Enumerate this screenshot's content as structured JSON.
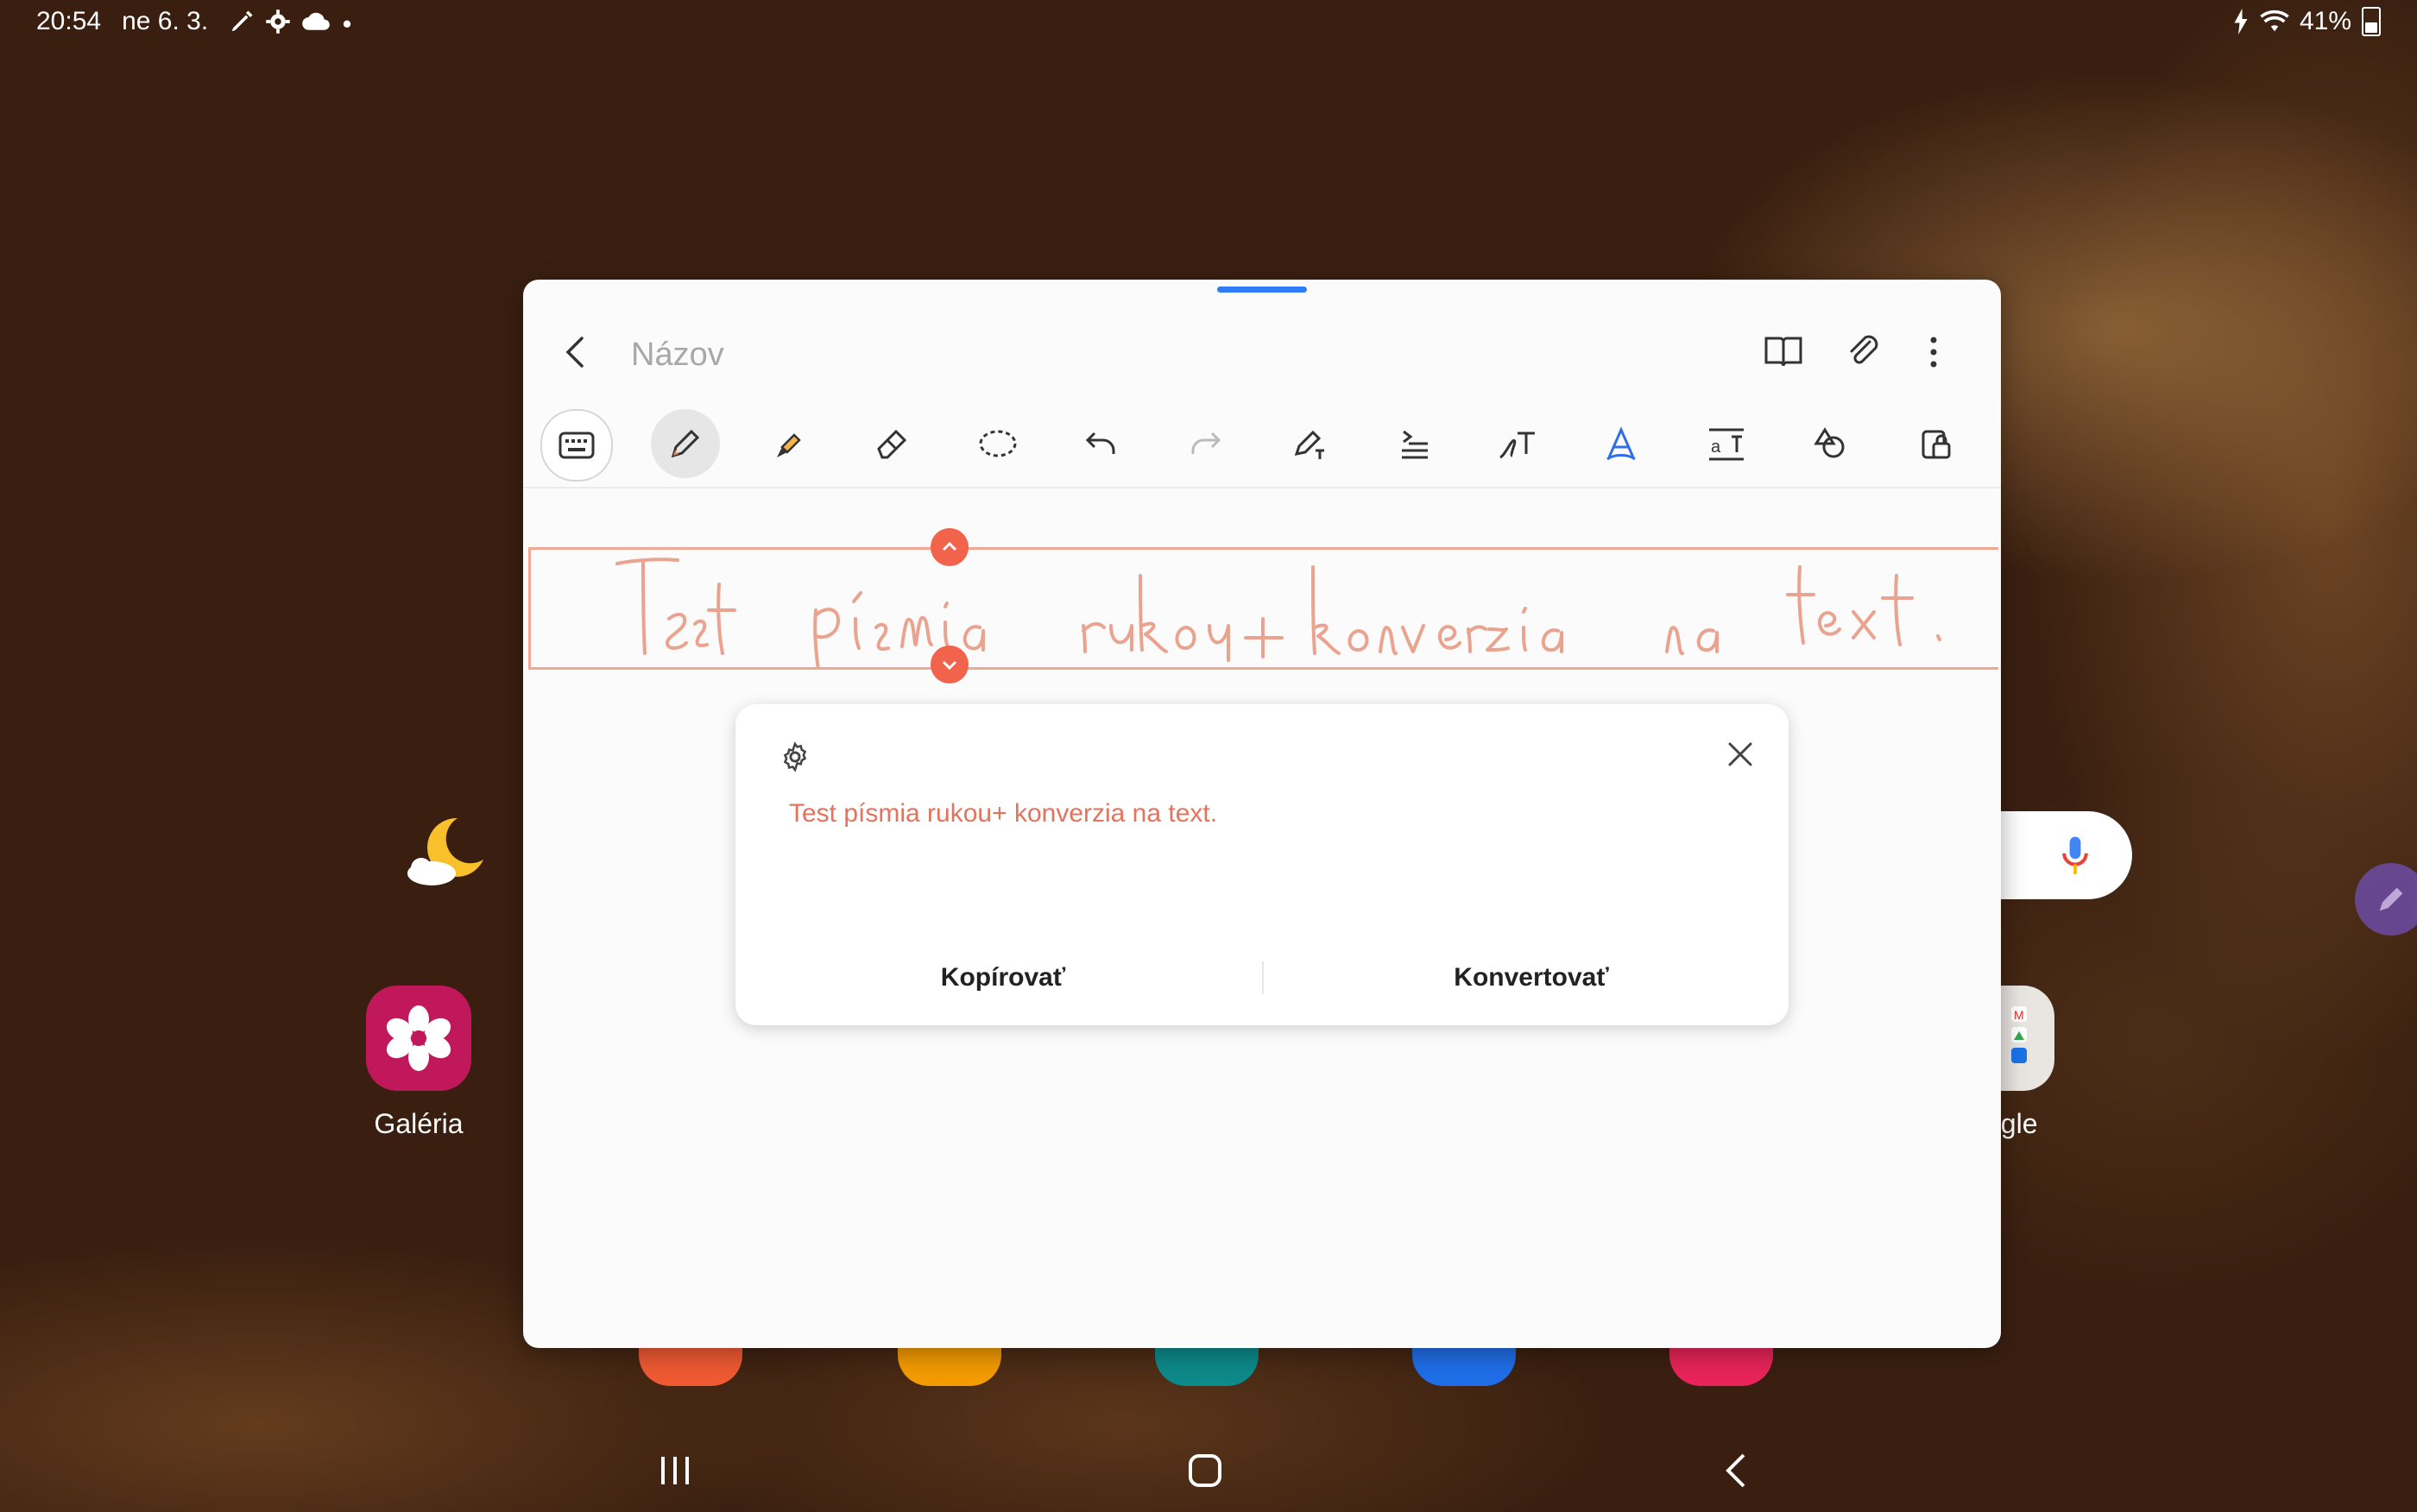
{
  "status_bar": {
    "time": "20:54",
    "date": "ne 6. 3.",
    "battery": "41%",
    "battery_level": 0.41,
    "icons": [
      "pen-icon",
      "gear-icon",
      "cloud-icon",
      "dot-icon",
      "charging-icon",
      "wifi-icon",
      "battery-icon"
    ]
  },
  "note": {
    "title_placeholder": "Názov",
    "header_icons": [
      "book-view-icon",
      "attach-icon",
      "more-icon"
    ],
    "toolbar": [
      "keyboard",
      "pen",
      "highlighter",
      "eraser",
      "lasso",
      "undo",
      "redo",
      "pen-to-text",
      "straighten",
      "handwriting-to-text",
      "text-style",
      "text-size",
      "shapes",
      "lock"
    ],
    "handwriting": "Test písmia rukou + konverzia na text.",
    "ink_color": "#eaa38f"
  },
  "convert_card": {
    "converted_text": "Test písmia rukou+ konverzia na text.",
    "copy_label": "Kopírovať",
    "convert_label": "Konvertovať"
  },
  "home": {
    "gallery_label": "Galéria",
    "google_label_partial": "ogle"
  },
  "colors": {
    "accent": "#2f7cf6",
    "handle": "#f1634b",
    "converted_text": "#e4735e",
    "gallery": "#c0185a"
  }
}
